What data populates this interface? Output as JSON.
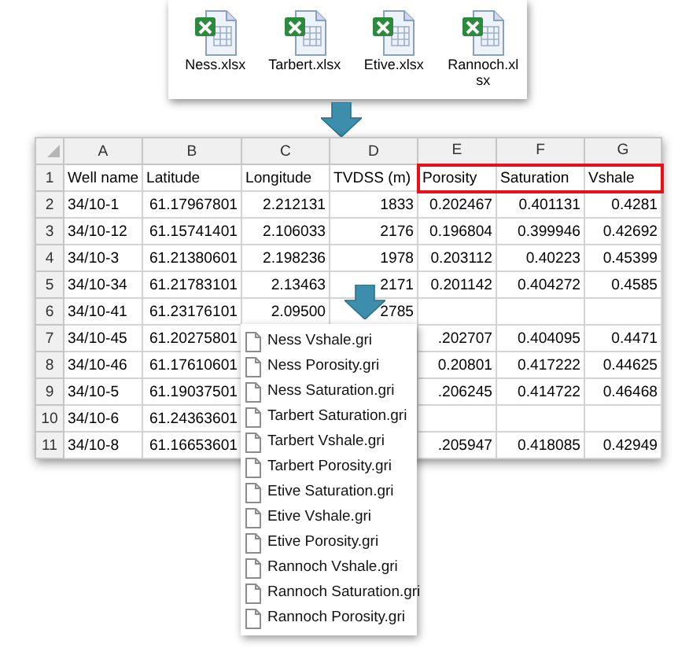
{
  "files": [
    {
      "name": "Ness.xlsx"
    },
    {
      "name": "Tarbert.xlsx"
    },
    {
      "name": "Etive.xlsx"
    },
    {
      "name": "Rannoch.xlsx"
    }
  ],
  "sheet": {
    "columns": [
      "A",
      "B",
      "C",
      "D",
      "E",
      "F",
      "G"
    ],
    "rows": [
      {
        "number": "1",
        "cells": [
          "Well name",
          "Latitude",
          "Longitude",
          "TVDSS (m)",
          "Porosity",
          "Saturation",
          "Vshale"
        ],
        "outlined": [
          false,
          false,
          false,
          false,
          true,
          true,
          true
        ]
      },
      {
        "number": "2",
        "cells": [
          "34/10-1",
          "61.17967801",
          "2.212131",
          "1833",
          "0.202467",
          "0.401131",
          "0.4281"
        ]
      },
      {
        "number": "3",
        "cells": [
          "34/10-12",
          "61.15741401",
          "2.106033",
          "2176",
          "0.196804",
          "0.399946",
          "0.42692"
        ]
      },
      {
        "number": "4",
        "cells": [
          "34/10-3",
          "61.21380601",
          "2.198236",
          "1978",
          "0.203112",
          "0.40223",
          "0.45399"
        ]
      },
      {
        "number": "5",
        "cells": [
          "34/10-34",
          "61.21783101",
          "2.13463",
          "2171",
          "0.201142",
          "0.404272",
          "0.4585"
        ]
      },
      {
        "number": "6",
        "cells": [
          "34/10-41",
          "61.23176101",
          "2.09500",
          "2785",
          null,
          null,
          null
        ]
      },
      {
        "number": "7",
        "cells": [
          "34/10-45",
          "61.20275801",
          null,
          null,
          ".202707",
          "0.404095",
          "0.4471"
        ]
      },
      {
        "number": "8",
        "cells": [
          "34/10-46",
          "61.17610601",
          null,
          null,
          "0.20801",
          "0.417222",
          "0.44625"
        ]
      },
      {
        "number": "9",
        "cells": [
          "34/10-5",
          "61.19037501",
          null,
          null,
          ".206245",
          "0.414722",
          "0.46468"
        ]
      },
      {
        "number": "10",
        "cells": [
          "34/10-6",
          "61.24363601",
          null,
          null,
          null,
          null,
          null
        ]
      },
      {
        "number": "11",
        "cells": [
          "34/10-8",
          "61.16653601",
          null,
          null,
          ".205947",
          "0.418085",
          "0.42949"
        ]
      }
    ]
  },
  "grid_files": [
    {
      "name": "Ness Vshale.gri"
    },
    {
      "name": "Ness Porosity.gri"
    },
    {
      "name": "Ness Saturation.gri"
    },
    {
      "name": "Tarbert Saturation.gri"
    },
    {
      "name": "Tarbert Vshale.gri"
    },
    {
      "name": "Tarbert Porosity.gri"
    },
    {
      "name": "Etive Saturation.gri"
    },
    {
      "name": "Etive Vshale.gri"
    },
    {
      "name": "Etive Porosity.gri"
    },
    {
      "name": "Rannoch Vshale.gri"
    },
    {
      "name": "Rannoch Saturation.gri"
    },
    {
      "name": "Rannoch Porosity.gri"
    }
  ]
}
